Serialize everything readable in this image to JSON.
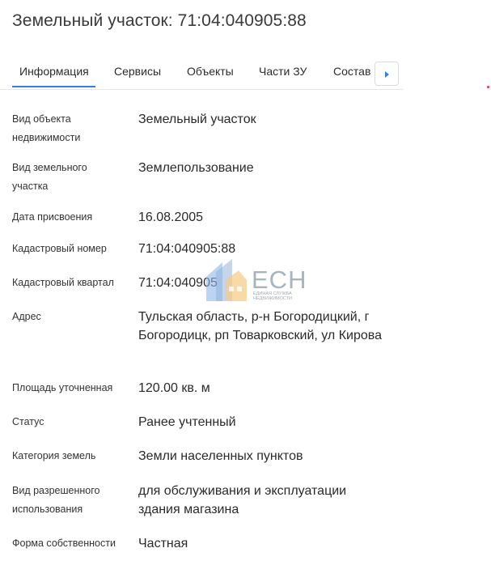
{
  "page": {
    "title": "Земельный участок: 71:04:040905:88"
  },
  "tabs": [
    {
      "label": "Информация",
      "active": true
    },
    {
      "label": "Сервисы",
      "active": false
    },
    {
      "label": "Объекты",
      "active": false
    },
    {
      "label": "Части ЗУ",
      "active": false
    },
    {
      "label": "Состав",
      "active": false
    }
  ],
  "tabs_scroll_icon": "chevron-right-icon",
  "details": [
    {
      "label": "Вид объекта недвижимости",
      "value": "Земельный участок"
    },
    {
      "label": "Вид земельного участка",
      "value": "Землепользование"
    },
    {
      "label": "Дата присвоения",
      "value": "16.08.2005"
    },
    {
      "label": "Кадастровый номер",
      "value": "71:04:040905:88"
    },
    {
      "label": "Кадастровый квартал",
      "value": "71:04:040905"
    },
    {
      "label": "Адрес",
      "value": "Тульская область, р-н Богородицкий, г Богородицк, рп Товарковский, ул Кирова"
    },
    {
      "label": "Площадь уточненная",
      "value": "120.00 кв. м"
    },
    {
      "label": "Статус",
      "value": "Ранее учтенный"
    },
    {
      "label": "Категория земель",
      "value": "Земли населенных пунктов"
    },
    {
      "label": "Вид разрешенного использования",
      "value": "для обслуживания и эксплуатации здания магазина"
    },
    {
      "label": "Форма собственности",
      "value": "Частная"
    }
  ],
  "watermark": {
    "logo_text": "ЕСН",
    "subtitle_line1": "ЕДИНАЯ СЛУЖБА",
    "subtitle_line2": "НЕДВИЖИМОСТИ"
  },
  "colors": {
    "accent": "#2f80ed",
    "text": "#2a2a2a",
    "divider": "#e5e7eb"
  }
}
